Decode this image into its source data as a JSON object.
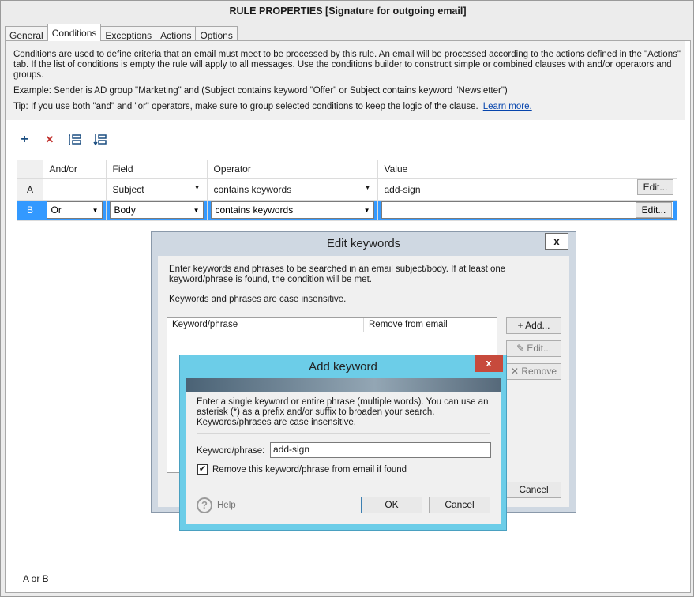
{
  "window": {
    "title": "RULE PROPERTIES [Signature for outgoing email]"
  },
  "tabs": [
    {
      "label": "General"
    },
    {
      "label": "Conditions"
    },
    {
      "label": "Exceptions"
    },
    {
      "label": "Actions"
    },
    {
      "label": "Options"
    }
  ],
  "conditions": {
    "description": "Conditions are used to define criteria that an email must meet to be processed by this rule. An email will be processed according to the actions defined in the \"Actions\" tab. If the list of conditions is empty the rule will apply to all messages. Use the conditions builder to construct simple or combined clauses with and/or operators and groups.",
    "example": "Example: Sender is AD group \"Marketing\" and (Subject contains keyword \"Offer\" or Subject contains keyword \"Newsletter\")",
    "tip": "Tip: If you use both \"and\" and \"or\" operators, make sure to group selected conditions to keep the logic of the clause.",
    "learn_more": "Learn more.",
    "toolbar": {
      "add_icon": "+",
      "delete_icon": "✕"
    },
    "columns": [
      "",
      "And/or",
      "Field",
      "Operator",
      "Value"
    ],
    "rows": [
      {
        "id": "A",
        "andor": "",
        "field": "Subject",
        "operator": "contains keywords",
        "value": "add-sign",
        "edit": "Edit..."
      },
      {
        "id": "B",
        "andor": "Or",
        "field": "Body",
        "operator": "contains keywords",
        "value": "",
        "edit": "Edit..."
      }
    ],
    "footer": "A or B"
  },
  "edit_keywords": {
    "title": "Edit keywords",
    "close": "x",
    "text1": "Enter keywords and phrases to be searched in an email subject/body. If at least one keyword/phrase is found, the condition will be met.",
    "text2": "Keywords and phrases are case insensitive.",
    "col_keyword": "Keyword/phrase",
    "col_remove": "Remove from email",
    "add": "+ Add...",
    "edit": "✎ Edit...",
    "remove": "✕ Remove",
    "cancel": "Cancel"
  },
  "add_keyword": {
    "title": "Add keyword",
    "close": "x",
    "text": "Enter a single keyword or entire phrase (multiple words). You can use an asterisk (*) as a prefix and/or suffix to broaden your search. Keywords/phrases are case insensitive.",
    "label": "Keyword/phrase:",
    "value": "add-sign",
    "checkbox_label": "Remove this keyword/phrase from email if found",
    "checked_mark": "✔",
    "help": "Help",
    "help_icon": "?",
    "ok": "OK",
    "cancel": "Cancel"
  }
}
